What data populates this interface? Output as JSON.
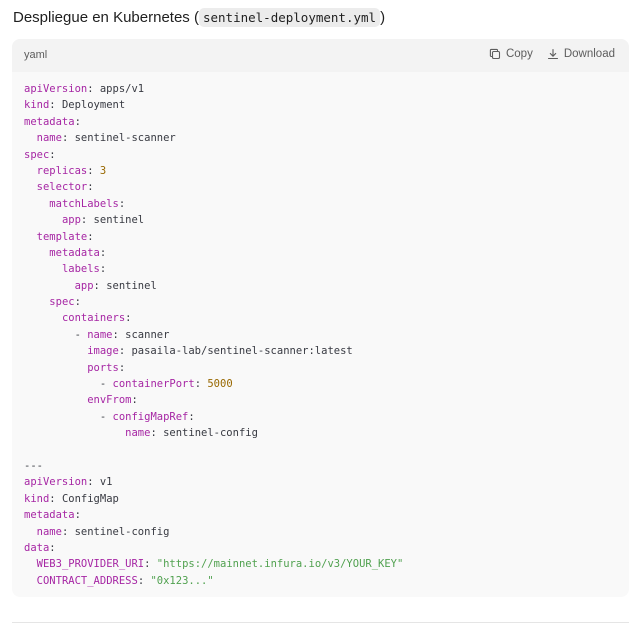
{
  "heading": {
    "prefix": "Despliegue en Kubernetes (",
    "filename": "sentinel-deployment.yml",
    "suffix": ")"
  },
  "code_block": {
    "language": "yaml",
    "copy_label": "Copy",
    "download_label": "Download",
    "lines": [
      [
        {
          "t": "k",
          "v": "apiVersion"
        },
        {
          "t": "p",
          "v": ": apps/v1"
        }
      ],
      [
        {
          "t": "k",
          "v": "kind"
        },
        {
          "t": "p",
          "v": ": Deployment"
        }
      ],
      [
        {
          "t": "k",
          "v": "metadata"
        },
        {
          "t": "p",
          "v": ":"
        }
      ],
      [
        {
          "t": "p",
          "v": "  "
        },
        {
          "t": "k",
          "v": "name"
        },
        {
          "t": "p",
          "v": ": sentinel-scanner"
        }
      ],
      [
        {
          "t": "k",
          "v": "spec"
        },
        {
          "t": "p",
          "v": ":"
        }
      ],
      [
        {
          "t": "p",
          "v": "  "
        },
        {
          "t": "k",
          "v": "replicas"
        },
        {
          "t": "p",
          "v": ": "
        },
        {
          "t": "n",
          "v": "3"
        }
      ],
      [
        {
          "t": "p",
          "v": "  "
        },
        {
          "t": "k",
          "v": "selector"
        },
        {
          "t": "p",
          "v": ":"
        }
      ],
      [
        {
          "t": "p",
          "v": "    "
        },
        {
          "t": "k",
          "v": "matchLabels"
        },
        {
          "t": "p",
          "v": ":"
        }
      ],
      [
        {
          "t": "p",
          "v": "      "
        },
        {
          "t": "k",
          "v": "app"
        },
        {
          "t": "p",
          "v": ": sentinel"
        }
      ],
      [
        {
          "t": "p",
          "v": "  "
        },
        {
          "t": "k",
          "v": "template"
        },
        {
          "t": "p",
          "v": ":"
        }
      ],
      [
        {
          "t": "p",
          "v": "    "
        },
        {
          "t": "k",
          "v": "metadata"
        },
        {
          "t": "p",
          "v": ":"
        }
      ],
      [
        {
          "t": "p",
          "v": "      "
        },
        {
          "t": "k",
          "v": "labels"
        },
        {
          "t": "p",
          "v": ":"
        }
      ],
      [
        {
          "t": "p",
          "v": "        "
        },
        {
          "t": "k",
          "v": "app"
        },
        {
          "t": "p",
          "v": ": sentinel"
        }
      ],
      [
        {
          "t": "p",
          "v": "    "
        },
        {
          "t": "k",
          "v": "spec"
        },
        {
          "t": "p",
          "v": ":"
        }
      ],
      [
        {
          "t": "p",
          "v": "      "
        },
        {
          "t": "k",
          "v": "containers"
        },
        {
          "t": "p",
          "v": ":"
        }
      ],
      [
        {
          "t": "p",
          "v": "        - "
        },
        {
          "t": "k",
          "v": "name"
        },
        {
          "t": "p",
          "v": ": scanner"
        }
      ],
      [
        {
          "t": "p",
          "v": "          "
        },
        {
          "t": "k",
          "v": "image"
        },
        {
          "t": "p",
          "v": ": pasaila-lab/sentinel-scanner:latest"
        }
      ],
      [
        {
          "t": "p",
          "v": "          "
        },
        {
          "t": "k",
          "v": "ports"
        },
        {
          "t": "p",
          "v": ":"
        }
      ],
      [
        {
          "t": "p",
          "v": "            - "
        },
        {
          "t": "k",
          "v": "containerPort"
        },
        {
          "t": "p",
          "v": ": "
        },
        {
          "t": "n",
          "v": "5000"
        }
      ],
      [
        {
          "t": "p",
          "v": "          "
        },
        {
          "t": "k",
          "v": "envFrom"
        },
        {
          "t": "p",
          "v": ":"
        }
      ],
      [
        {
          "t": "p",
          "v": "            - "
        },
        {
          "t": "k",
          "v": "configMapRef"
        },
        {
          "t": "p",
          "v": ":"
        }
      ],
      [
        {
          "t": "p",
          "v": "                "
        },
        {
          "t": "k",
          "v": "name"
        },
        {
          "t": "p",
          "v": ": sentinel-config"
        }
      ],
      [],
      [
        {
          "t": "p",
          "v": "---"
        }
      ],
      [
        {
          "t": "k",
          "v": "apiVersion"
        },
        {
          "t": "p",
          "v": ": v1"
        }
      ],
      [
        {
          "t": "k",
          "v": "kind"
        },
        {
          "t": "p",
          "v": ": ConfigMap"
        }
      ],
      [
        {
          "t": "k",
          "v": "metadata"
        },
        {
          "t": "p",
          "v": ":"
        }
      ],
      [
        {
          "t": "p",
          "v": "  "
        },
        {
          "t": "k",
          "v": "name"
        },
        {
          "t": "p",
          "v": ": sentinel-config"
        }
      ],
      [
        {
          "t": "k",
          "v": "data"
        },
        {
          "t": "p",
          "v": ":"
        }
      ],
      [
        {
          "t": "p",
          "v": "  "
        },
        {
          "t": "k",
          "v": "WEB3_PROVIDER_URI"
        },
        {
          "t": "p",
          "v": ": "
        },
        {
          "t": "s",
          "v": "\"https://mainnet.infura.io/v3/YOUR_KEY\""
        }
      ],
      [
        {
          "t": "p",
          "v": "  "
        },
        {
          "t": "k",
          "v": "CONTRACT_ADDRESS"
        },
        {
          "t": "p",
          "v": ": "
        },
        {
          "t": "s",
          "v": "\"0x123...\""
        }
      ]
    ]
  },
  "icons": {
    "copy": "copy-icon",
    "download": "download-icon"
  },
  "colors": {
    "key": "#a626a4",
    "string": "#50a14f",
    "number": "#986801",
    "plain": "#383a42"
  }
}
